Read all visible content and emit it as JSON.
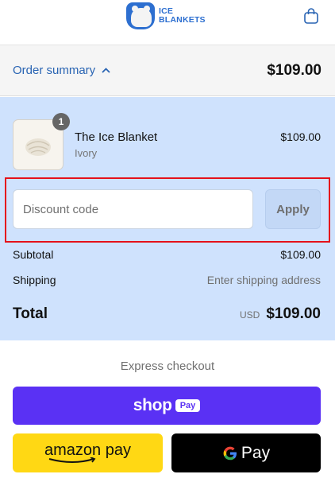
{
  "header": {
    "logo_line1": "ICE",
    "logo_line2": "BLANKETS",
    "cart_icon": "shopping-bag-icon"
  },
  "summary": {
    "toggle_label": "Order summary",
    "toggle_icon": "chevron-up-icon",
    "total": "$109.00"
  },
  "product": {
    "quantity": "1",
    "name": "The Ice Blanket",
    "variant": "Ivory",
    "price": "$109.00"
  },
  "discount": {
    "placeholder": "Discount code",
    "value": "",
    "apply_label": "Apply"
  },
  "totals": {
    "subtotal_label": "Subtotal",
    "subtotal_value": "$109.00",
    "shipping_label": "Shipping",
    "shipping_value": "Enter shipping address",
    "total_label": "Total",
    "currency": "USD",
    "total_value": "$109.00"
  },
  "express": {
    "title": "Express checkout",
    "shop_label": "shop",
    "shop_pay_label": "Pay",
    "amazon_label": "amazon pay",
    "gpay_label": "Pay"
  },
  "colors": {
    "accent": "#2964b3",
    "panel": "#cfe2fd",
    "highlight": "#e5121b",
    "shop_pay": "#5a31f4",
    "amazon": "#ffd814"
  }
}
